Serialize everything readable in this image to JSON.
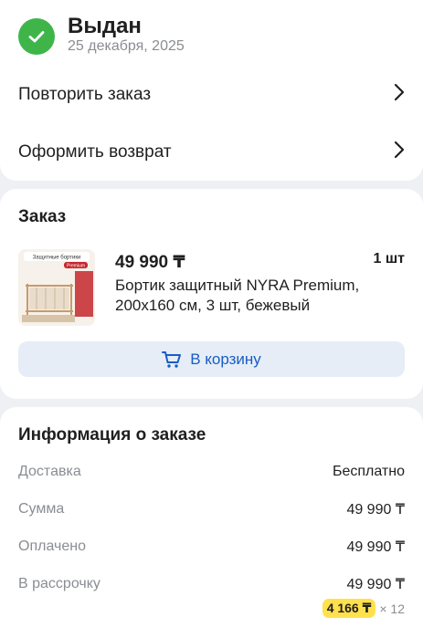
{
  "status": {
    "title": "Выдан",
    "date": "25 декабря, 2025",
    "icon": "check-icon",
    "color": "#3fb549"
  },
  "actions": [
    {
      "label": "Повторить заказ",
      "icon": "chevron-right-icon"
    },
    {
      "label": "Оформить возврат",
      "icon": "chevron-right-icon"
    }
  ],
  "order": {
    "title": "Заказ",
    "product": {
      "price": "49 990 ₸",
      "quantity": "1 шт",
      "name": "Бортик защитный NYRA Premium, 200x160 см, 3 шт, бежевый",
      "image_text": {
        "heading": "Защитные бортики",
        "tag": "Premium"
      }
    },
    "cart_button": {
      "label": "В корзину",
      "icon": "cart-icon"
    }
  },
  "info": {
    "title": "Информация о заказе",
    "rows": [
      {
        "label": "Доставка",
        "value": "Бесплатно"
      },
      {
        "label": "Сумма",
        "value": "49 990 ₸"
      },
      {
        "label": "Оплачено",
        "value": "49 990 ₸"
      },
      {
        "label": "В рассрочку",
        "value": "49 990 ₸"
      }
    ],
    "installment": {
      "monthly": "4 166 ₸",
      "months": "× 12"
    }
  },
  "colors": {
    "accent": "#1a5cc4",
    "button_bg": "#e6edf6",
    "installment_badge": "#ffe14d",
    "background": "#eef0f4"
  }
}
